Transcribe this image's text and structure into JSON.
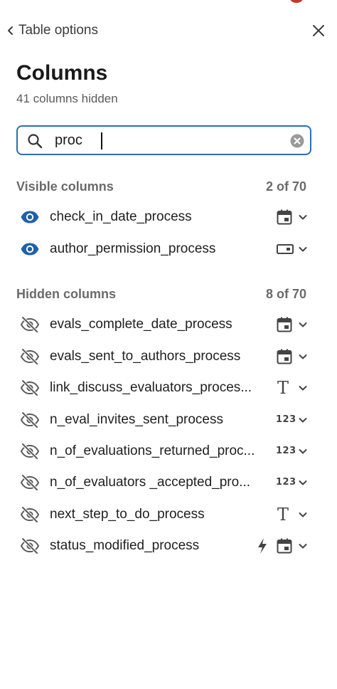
{
  "header": {
    "back_label": "Table options"
  },
  "panel": {
    "title": "Columns",
    "subtitle": "41 columns hidden"
  },
  "search": {
    "value": "proc"
  },
  "visible_section": {
    "label": "Visible columns",
    "count": "2 of 70",
    "items": [
      {
        "name": "check_in_date_process",
        "type_icon": "calendar-icon"
      },
      {
        "name": "author_permission_process",
        "type_icon": "switch-field-icon"
      }
    ]
  },
  "hidden_section": {
    "label": "Hidden columns",
    "count": "8 of 70",
    "items": [
      {
        "name": "evals_complete_date_process",
        "type_icon": "calendar-icon"
      },
      {
        "name": "evals_sent_to_authors_process",
        "type_icon": "calendar-icon"
      },
      {
        "name": "link_discuss_evaluators_proces...",
        "type_icon": "text-icon",
        "type_label": "T"
      },
      {
        "name": "n_eval_invites_sent_process",
        "type_icon": "number-icon",
        "type_label": "123"
      },
      {
        "name": "n_of_evaluations_returned_proc...",
        "type_icon": "number-icon",
        "type_label": "123"
      },
      {
        "name": "n_of_evaluators _accepted_pro...",
        "type_icon": "number-icon",
        "type_label": "123"
      },
      {
        "name": "next_step_to_do_process",
        "type_icon": "text-icon",
        "type_label": "T"
      },
      {
        "name": "status_modified_process",
        "type_icon": "calendar-icon",
        "extra_icon": "lightning-icon"
      }
    ]
  },
  "colors": {
    "accent": "#2a6eb8",
    "visible_eye": "#1e5fad",
    "hidden_eye": "#5a5a5a"
  }
}
